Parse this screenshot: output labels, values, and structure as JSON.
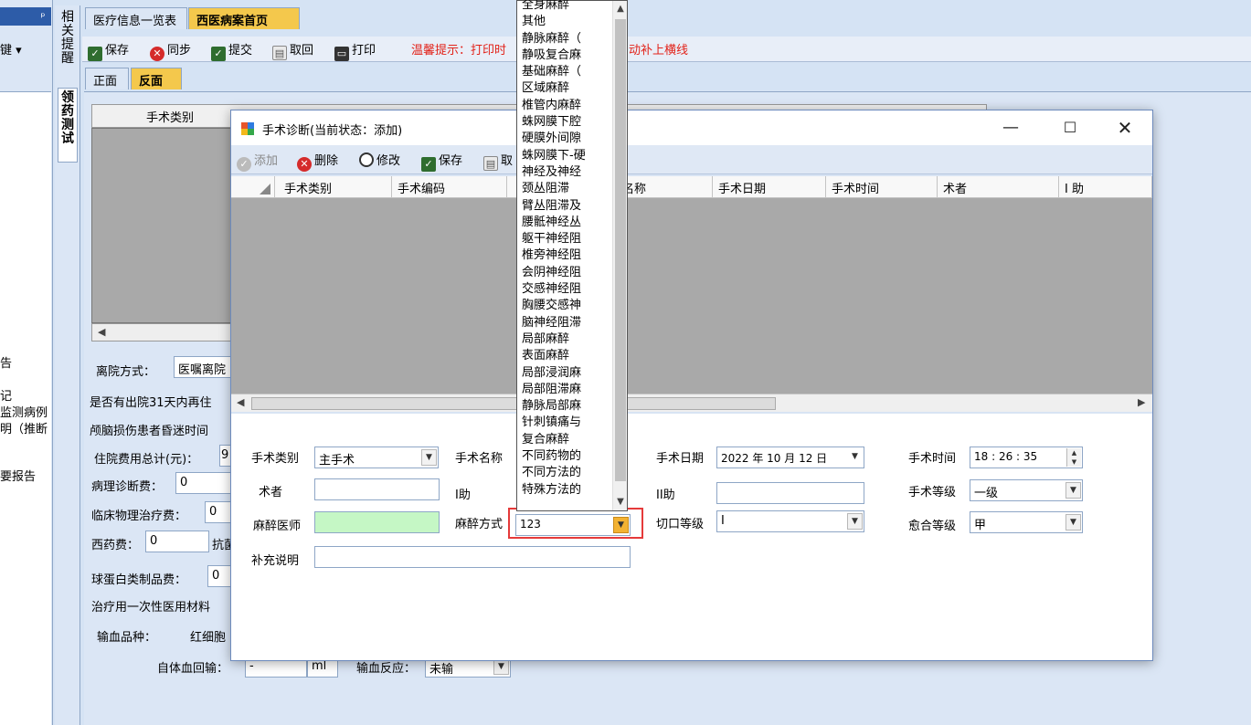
{
  "left_panel": {
    "pin": "ᵖ",
    "key_label": "键 ▾",
    "items": [
      "告",
      "记",
      "监测病例",
      "明（推断",
      "要报告"
    ]
  },
  "vertical_tabs": {
    "remind": "相关提醒",
    "test": "领药测试"
  },
  "top_tabs": [
    "医疗信息一览表",
    "西医病案首页"
  ],
  "toolbar": {
    "save": "保存",
    "sync": "同步",
    "submit": "提交",
    "fetch": "取回",
    "print": "打印",
    "tip": "温馨提示：打印时",
    "tip_tail": "动补上横线"
  },
  "sub_tabs": [
    "正面",
    "反面"
  ],
  "background_form": {
    "grid_col1": "手术类别",
    "discharge_method_label": "离院方式：",
    "discharge_method_value": "医嘱离院",
    "readmit_label": "是否有出院31天内再住",
    "coma_label": "颅脑损伤患者昏迷时间",
    "total_cost_label": "住院费用总计(元)：",
    "total_cost_value": "9",
    "pathology_label": "病理诊断费：",
    "pathology_value": "0",
    "physio_label": "临床物理治疗费：",
    "physio_value": "0",
    "western_drug_label": "西药费：",
    "western_drug_value": "0",
    "antibiotic_label": "抗菌",
    "globulin_label": "球蛋白类制品费：",
    "globulin_value": "0",
    "disposable_label": "治疗用一次性医用材料",
    "transfusion_label": "输血品种：",
    "rbc_label": "红细胞",
    "autologous_label": "自体血回输：",
    "autologous_value": "-",
    "unit_ml": "ml",
    "reaction_label": "输血反应：",
    "reaction_value": "未输"
  },
  "dialog": {
    "title": "手术诊断(当前状态：添加)",
    "toolbar": {
      "add": "添加",
      "delete": "删除",
      "edit": "修改",
      "save": "保存",
      "fetch": "取"
    },
    "grid_headers": [
      "手术类别",
      "手术编码",
      "",
      "名称",
      "手术日期",
      "手术时间",
      "术者",
      "I 助"
    ],
    "form": {
      "category_label": "手术类别",
      "category_value": "主手术",
      "name_label": "手术名称",
      "date_label": "手术日期",
      "date_value": "2022 年 10 月 12 日",
      "time_label": "手术时间",
      "time_value": "18 : 26 : 35",
      "surgeon_label": "术者",
      "assistant1_label": "I助",
      "assistant2_label": "II助",
      "level_label": "手术等级",
      "level_value": "一级",
      "anesthetist_label": "麻醉医师",
      "anes_method_label": "麻醉方式",
      "anes_method_value": "123",
      "incision_label": "切口等级",
      "incision_value": "I",
      "healing_label": "愈合等级",
      "healing_value": "甲",
      "note_label": "补充说明"
    }
  },
  "dropdown": {
    "items": [
      "全身麻醉",
      "其他",
      "静脉麻醉（",
      "静吸复合麻",
      "基础麻醉（",
      "区域麻醉",
      "椎管内麻醉",
      "蛛网膜下腔",
      "硬膜外间隙",
      "蛛网膜下-硬",
      "神经及神经",
      "颈丛阻滞",
      "臂丛阻滞及",
      "腰骶神经丛",
      "躯干神经阻",
      "椎旁神经阻",
      "会阴神经阻",
      "交感神经阻",
      "胸腰交感神",
      "脑神经阻滞",
      "局部麻醉",
      "表面麻醉",
      "局部浸润麻",
      "局部阻滞麻",
      "静脉局部麻",
      "针刺镇痛与",
      "复合麻醉",
      "不同药物的",
      "不同方法的",
      "特殊方法的"
    ]
  },
  "colors": {
    "active_tab": "#f4c84c",
    "tip_text": "#e2231a",
    "anesthetist_field": "#c5f7c5",
    "highlight_box": "#e53a3a"
  }
}
